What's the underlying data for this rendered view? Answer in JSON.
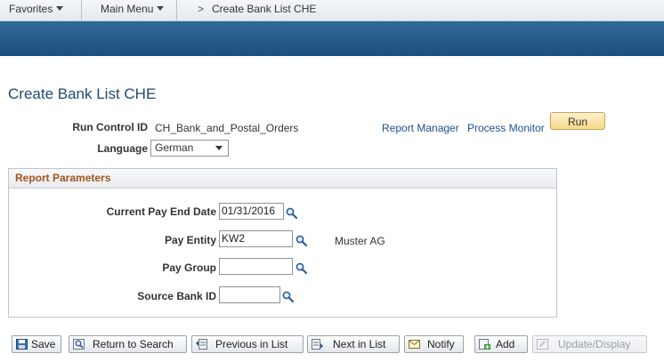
{
  "nav": {
    "favorites": "Favorites",
    "main_menu": "Main Menu",
    "breadcrumb_arrow": ">",
    "breadcrumb_current": "Create Bank List CHE"
  },
  "page": {
    "title": "Create Bank List CHE"
  },
  "run_control": {
    "label": "Run Control ID",
    "value": "CH_Bank_and_Postal_Orders",
    "report_manager": "Report Manager",
    "process_monitor": "Process Monitor",
    "run_label": "Run"
  },
  "language": {
    "label": "Language",
    "selected": "German"
  },
  "report_parameters": {
    "title": "Report Parameters",
    "pay_end_date": {
      "label": "Current Pay End Date",
      "value": "01/31/2016"
    },
    "pay_entity": {
      "label": "Pay Entity",
      "value": "KW2",
      "description": "Muster AG"
    },
    "pay_group": {
      "label": "Pay Group",
      "value": ""
    },
    "source_bank": {
      "label": "Source Bank ID",
      "value": ""
    }
  },
  "toolbar": {
    "save": "Save",
    "return_to_search": "Return to Search",
    "previous_in_list": "Previous in List",
    "next_in_list": "Next in List",
    "notify": "Notify",
    "add": "Add",
    "update_display": "Update/Display"
  },
  "colors": {
    "banner": "#1d4f7c",
    "title": "#22486e",
    "group_title": "#a2531c",
    "link": "#1f4f8f"
  }
}
